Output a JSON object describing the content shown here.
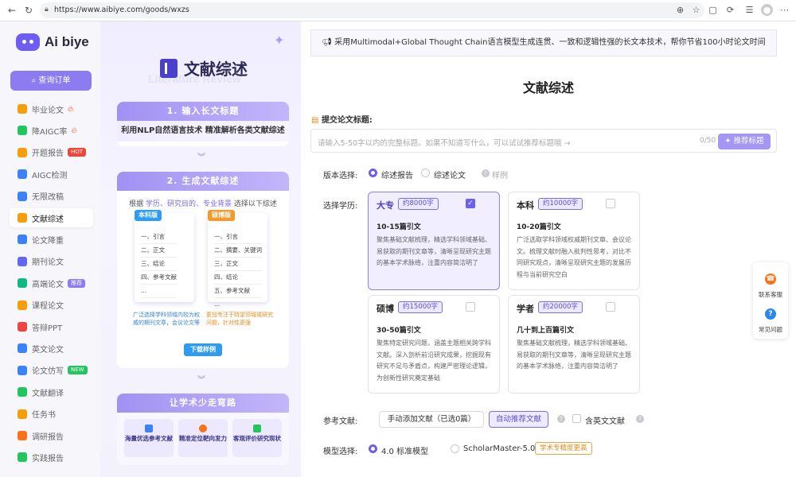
{
  "browser": {
    "url": "https://www.aibiye.com/goods/wxzs"
  },
  "sidebar": {
    "logo_text": "Ai biye",
    "query_button": "查询订单",
    "items": [
      {
        "label": "毕业论文",
        "icon": "thesis-icon",
        "flag": "fire"
      },
      {
        "label": "降AIGC率",
        "icon": "aigc-reduce-icon",
        "flag": "fire"
      },
      {
        "label": "开题报告",
        "icon": "proposal-icon",
        "badge": "HOT"
      },
      {
        "label": "AIGC检测",
        "icon": "aigc-detect-icon"
      },
      {
        "label": "无限改稿",
        "icon": "unlimited-revise-icon"
      },
      {
        "label": "文献综述",
        "icon": "literature-review-icon",
        "active": true
      },
      {
        "label": "论文降重",
        "icon": "plagiarism-reduce-icon"
      },
      {
        "label": "期刊论文",
        "icon": "journal-icon"
      },
      {
        "label": "高端论文",
        "icon": "premium-icon",
        "badge": "推荐"
      },
      {
        "label": "课程论文",
        "icon": "course-icon"
      },
      {
        "label": "答辩PPT",
        "icon": "ppt-icon"
      },
      {
        "label": "英文论文",
        "icon": "english-icon"
      },
      {
        "label": "论文仿写",
        "icon": "imitate-icon",
        "badge": "NEW"
      },
      {
        "label": "文献翻译",
        "icon": "translate-icon"
      },
      {
        "label": "任务书",
        "icon": "task-book-icon"
      },
      {
        "label": "调研报告",
        "icon": "survey-icon"
      },
      {
        "label": "实践报告",
        "icon": "practice-icon"
      }
    ]
  },
  "promo": {
    "title": "文献综述",
    "subtitle_en": "Literature Review",
    "step1_title": "1. 输入长文标题",
    "step1_text": "利用NLP自然语言技术 精准解析各类文献综述",
    "step2_title": "2. 生成文献综述",
    "step2_prefix": "根据",
    "step2_hl": "学历、研究目的、专业背景",
    "step2_suffix": "选择以下综述",
    "doc_left": {
      "tag": "本科版",
      "lines": [
        "一、引言",
        "二、正文",
        "三、结论",
        "四、参考文献",
        "..."
      ],
      "note": "广泛选择学科领域内较为权威的期刊文章，会议论文等"
    },
    "doc_right": {
      "tag": "硕博版",
      "lines": [
        "一、引言",
        "二、摘要、关键词",
        "三、正文",
        "四、结论",
        "五、参考文献",
        "..."
      ],
      "note": "更加专注于特定领域或研究问题，针对性更强"
    },
    "download_btn": "下载样例",
    "step3_title": "让学术少走弯路",
    "features": [
      "海量优选参考文献",
      "精准定位靶向发力",
      "客观评价研究现状"
    ]
  },
  "main": {
    "banner": "采用Multimodal+Global Thought Chain语言模型生成连贯、一致和逻辑性强的长文本技术，帮你节省100小时论文时间",
    "page_title": "文献综述",
    "title_label": "提交论文标题:",
    "title_placeholder": "请输入5-50字以内的完整标题。如果不知道写什么，可以试试推荐标题哦 →",
    "title_count": "0/50",
    "recommend_btn": "推荐标题",
    "version_label": "版本选择:",
    "version_options": [
      "综述报告",
      "综述论文"
    ],
    "sample_link": "样例",
    "edu_label": "选择学历:",
    "edu_cards": [
      {
        "name": "大专",
        "words": "约8000字",
        "count": "10-15篇引文",
        "desc": "聚焦基础文献梳理，精选学科领域基础、易获取的期刊文章等，清晰呈现研究主题的基本学术脉络，注重内容简洁明了",
        "selected": true
      },
      {
        "name": "本科",
        "words": "约10000字",
        "count": "10-20篇引文",
        "desc": "广泛选取学科领域权威期刊文章、会议论文。梳理文献时融入批判性思考，对比不同研究观点，清晰呈现研究主题的发展历程与当前研究空白",
        "selected": false
      },
      {
        "name": "硕博",
        "words": "约15000字",
        "count": "30-50篇引文",
        "desc": "聚焦特定研究问题，涵盖主题相关跨学科文献。深入剖析前沿研究成果，挖掘现有研究不足与矛盾点，构建严密理论逻辑，为创新性研究奠定基础",
        "selected": false
      },
      {
        "name": "学者",
        "words": "约20000字",
        "count": "几十到上百篇引文",
        "desc": "聚焦基础文献梳理，精选学科领域基础、易获取的期刊文章等，清晰呈现研究主题的基本学术脉络，注重内容简洁明了",
        "selected": false
      }
    ],
    "refs_label": "参考文献:",
    "manual_refs_btn": "手动添加文献（已选0篇）",
    "auto_refs_btn": "自动推荐文献",
    "english_refs": "含英文文献",
    "model_label": "模型选择:",
    "model_options": [
      "4.0 标准模型",
      "ScholarMaster-5.0"
    ],
    "model_tag": "学术专精度更高"
  },
  "float_panel": {
    "service": "联系客服",
    "faq": "常见问题"
  }
}
